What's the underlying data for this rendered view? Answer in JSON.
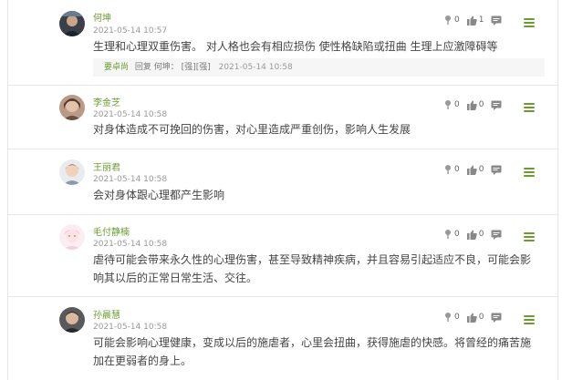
{
  "comments": [
    {
      "name": "何坤",
      "time": "2021-05-14 10:57",
      "text": "生理和心理双重伤害。 对人格也会有相应损伤 使性格缺陷或扭曲 生理上应激障碍等",
      "likes": "0",
      "thumbs": "1",
      "reply": {
        "name": "要卓尚",
        "verb": "回复",
        "to": "何坤：",
        "content": "[强][强]",
        "time": "2021-05-14 10:58"
      }
    },
    {
      "name": "李金芝",
      "time": "2021-05-14 10:58",
      "text": "对身体造成不可挽回的伤害，对心里造成严重创伤，影响人生发展",
      "likes": "0",
      "thumbs": "0"
    },
    {
      "name": "王丽君",
      "time": "2021-05-14 10:58",
      "text": "会对身体跟心理都产生影响",
      "likes": "0",
      "thumbs": "0"
    },
    {
      "name": "毛付静楠",
      "time": "2021-05-14 10:58",
      "text": "虐待可能会带来永久性的心理伤害，甚至导致精神疾病，并且容易引起适应不良，可能会影响其以后的正常日常生活、交往。",
      "likes": "0",
      "thumbs": "0"
    },
    {
      "name": "孙晨慧",
      "time": "2021-05-14 10:58",
      "text": "可能会影响心理健康，变成以后的施虐者，心里会扭曲，获得施虐的快感。将曾经的痛苦施加在更弱者的身上。",
      "likes": "0",
      "thumbs": "0"
    }
  ],
  "colors": {
    "accent": "#6a9c2f",
    "divider": "#e6e6e6",
    "reply_bg": "#f6f6f6"
  },
  "icons": {
    "flower": "flower-icon",
    "thumb": "thumbs-up-icon",
    "chat": "chat-icon",
    "menu": "menu-icon"
  }
}
